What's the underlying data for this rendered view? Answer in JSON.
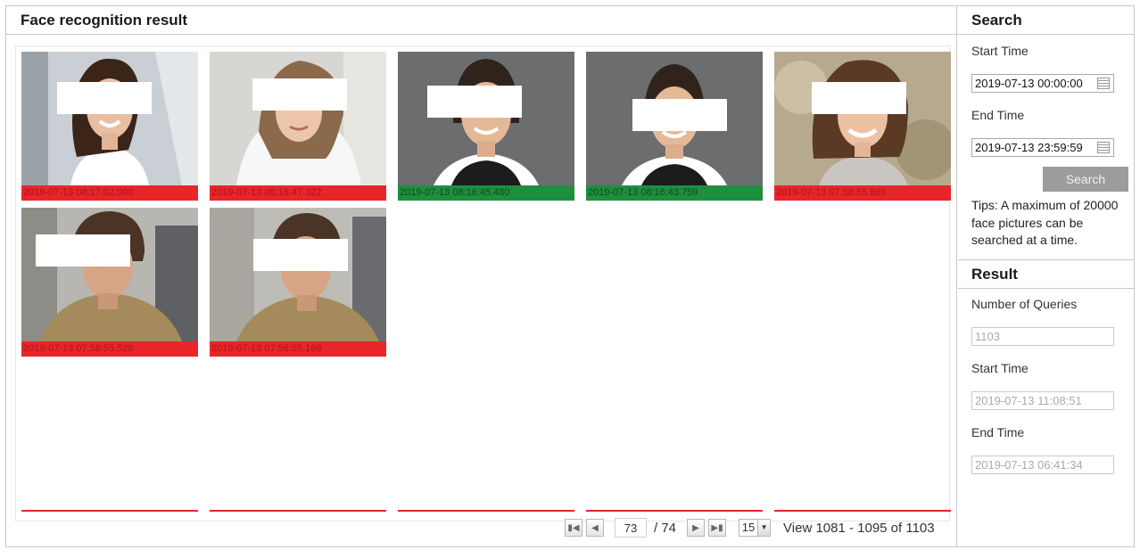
{
  "main": {
    "title": "Face recognition result"
  },
  "cards": [
    {
      "timestamp": "2019-07-13 08:17:02.090",
      "status": "red"
    },
    {
      "timestamp": "2019-07-13 08:16:47.322",
      "status": "red"
    },
    {
      "timestamp": "2019-07-13 08:16:45.480",
      "status": "green"
    },
    {
      "timestamp": "2019-07-13 08:16:43.759",
      "status": "green"
    },
    {
      "timestamp": "2019-07-13 07:58:55.889",
      "status": "red"
    },
    {
      "timestamp": "2019-07-13 07:58:55.528",
      "status": "red"
    },
    {
      "timestamp": "2019-07-13 07:58:55.168",
      "status": "red"
    }
  ],
  "colors": {
    "match_red": "#e8262a",
    "match_green": "#1e8f3e",
    "button_gray": "#9c9c9c"
  },
  "pager": {
    "current_page": "73",
    "total_pages": "/ 74",
    "page_size": "15",
    "view_text": "View 1081 - 1095 of 1103",
    "icons": [
      "first-page-icon",
      "prev-page-icon",
      "next-page-icon",
      "last-page-icon"
    ]
  },
  "search": {
    "title": "Search",
    "start_label": "Start Time",
    "start_value": "2019-07-13 00:00:00",
    "end_label": "End Time",
    "end_value": "2019-07-13 23:59:59",
    "button_label": "Search",
    "tips": "Tips: A maximum of 20000 face pictures can be searched at a time."
  },
  "result": {
    "title": "Result",
    "queries_label": "Number of Queries",
    "queries_value": "1103",
    "start_label": "Start Time",
    "start_value": "2019-07-13  11:08:51",
    "end_label": "End Time",
    "end_value": "2019-07-13  06:41:34"
  }
}
